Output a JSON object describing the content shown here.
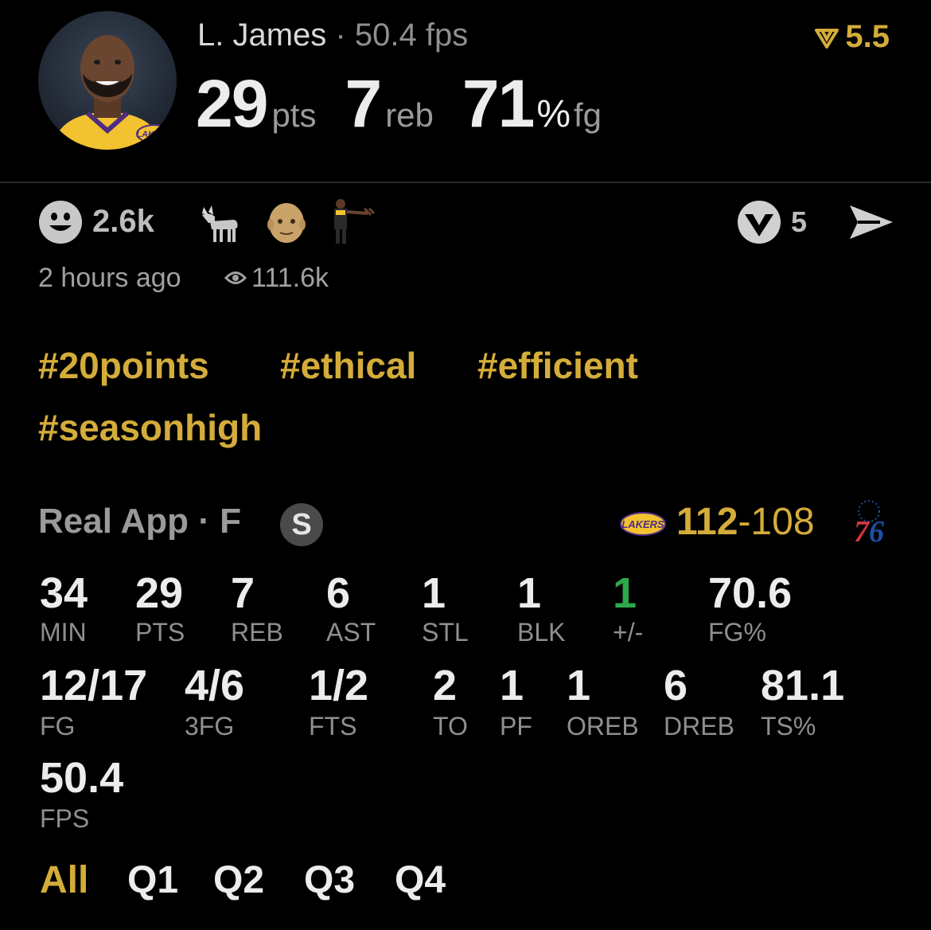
{
  "header": {
    "player_name": "L. James",
    "separator": "·",
    "fps_text": "50.4 fps",
    "rating": "5.5",
    "stats": [
      {
        "value": "29",
        "unit": "pts"
      },
      {
        "value": "7",
        "unit": "reb"
      },
      {
        "value": "71",
        "pct": "%",
        "unit": "fg"
      }
    ]
  },
  "reactions": {
    "count": "2.6k",
    "icons": [
      "smiley-icon",
      "goat-icon",
      "bald-face-icon",
      "player-figure-icon"
    ]
  },
  "share": {
    "count": "5"
  },
  "meta": {
    "time_ago": "2 hours ago",
    "views": "111.6k"
  },
  "tags": [
    "#20points",
    "#ethical",
    "#efficient",
    "#seasonhigh"
  ],
  "game": {
    "source": "Real App · F",
    "badge": "S",
    "home_score": "112",
    "dash": "-",
    "away_score": "108",
    "away_logo_text": "76"
  },
  "stat_rows": [
    [
      {
        "value": "34",
        "label": "MIN"
      },
      {
        "value": "29",
        "label": "PTS"
      },
      {
        "value": "7",
        "label": "REB"
      },
      {
        "value": "6",
        "label": "AST"
      },
      {
        "value": "1",
        "label": "STL"
      },
      {
        "value": "1",
        "label": "BLK"
      },
      {
        "value": "1",
        "label": "+/-"
      },
      {
        "value": "70.6",
        "label": "FG%"
      }
    ],
    [
      {
        "value": "12/17",
        "label": "FG"
      },
      {
        "value": "4/6",
        "label": "3FG"
      },
      {
        "value": "1/2",
        "label": "FTS"
      },
      {
        "value": "2",
        "label": "TO"
      },
      {
        "value": "1",
        "label": "PF"
      },
      {
        "value": "1",
        "label": "OREB"
      },
      {
        "value": "6",
        "label": "DREB"
      },
      {
        "value": "81.1",
        "label": "TS%"
      }
    ],
    [
      {
        "value": "50.4",
        "label": "FPS"
      }
    ]
  ],
  "tabs": [
    "All",
    "Q1",
    "Q2",
    "Q3",
    "Q4"
  ],
  "colors": {
    "accent": "#d4ac3a",
    "positive": "#2ea84a",
    "background": "#000000"
  }
}
